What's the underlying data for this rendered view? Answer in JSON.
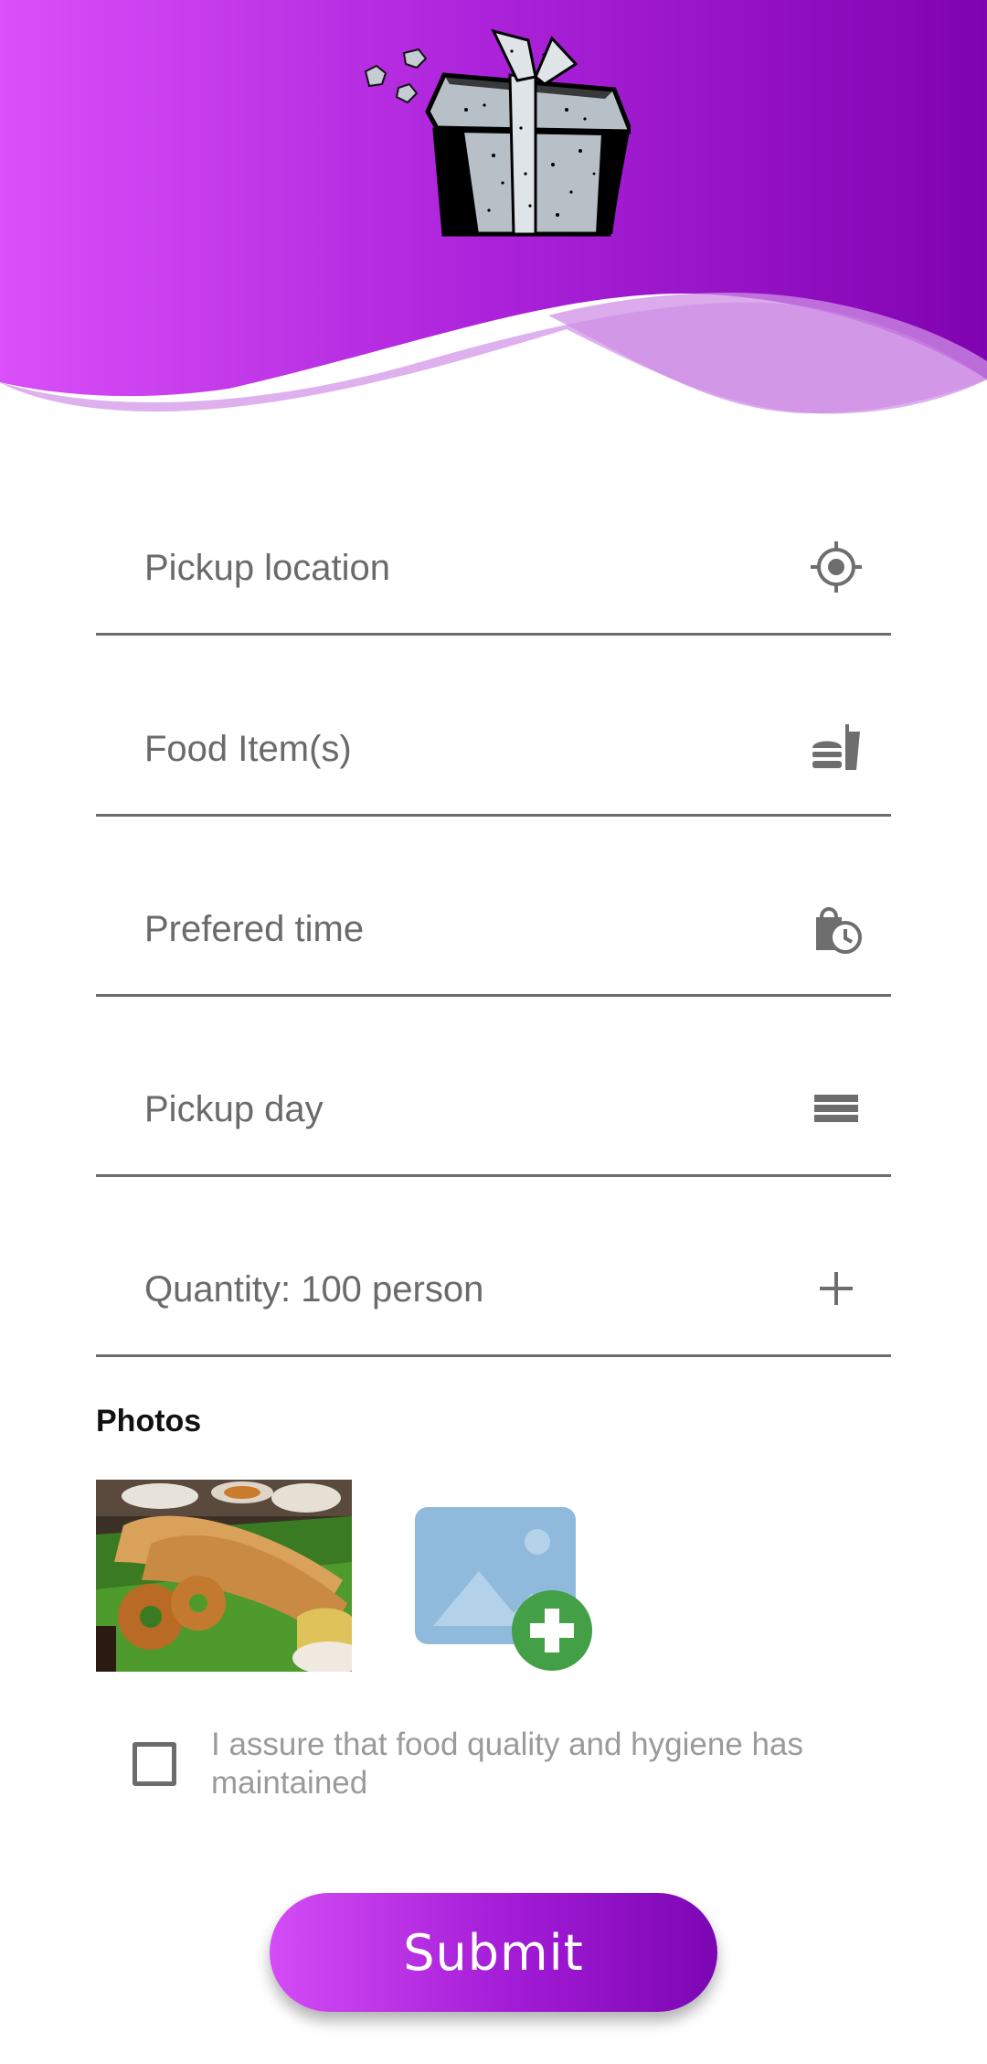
{
  "form": {
    "fields": [
      {
        "label": "Pickup location",
        "icon": "gps-target-icon"
      },
      {
        "label": "Food Item(s)",
        "icon": "fastfood-icon"
      },
      {
        "label": "Prefered time",
        "icon": "bag-clock-icon"
      },
      {
        "label": "Pickup day",
        "icon": "calendar-lines-icon"
      },
      {
        "label": "Quantity: 100 person",
        "icon": "plus-icon"
      }
    ]
  },
  "photos": {
    "title": "Photos",
    "add_icon": "add-photo-icon"
  },
  "assurance": {
    "text": "I assure that food quality and hygiene has maintained",
    "checked": false
  },
  "submit": {
    "label": "Submit"
  },
  "colors": {
    "accent_start": "#d44cf5",
    "accent_end": "#7c06b3",
    "field_text": "#6a6a6a",
    "underline": "#6c6c6c",
    "add_badge": "#43a047",
    "photo_placeholder": "#8fbadb"
  }
}
